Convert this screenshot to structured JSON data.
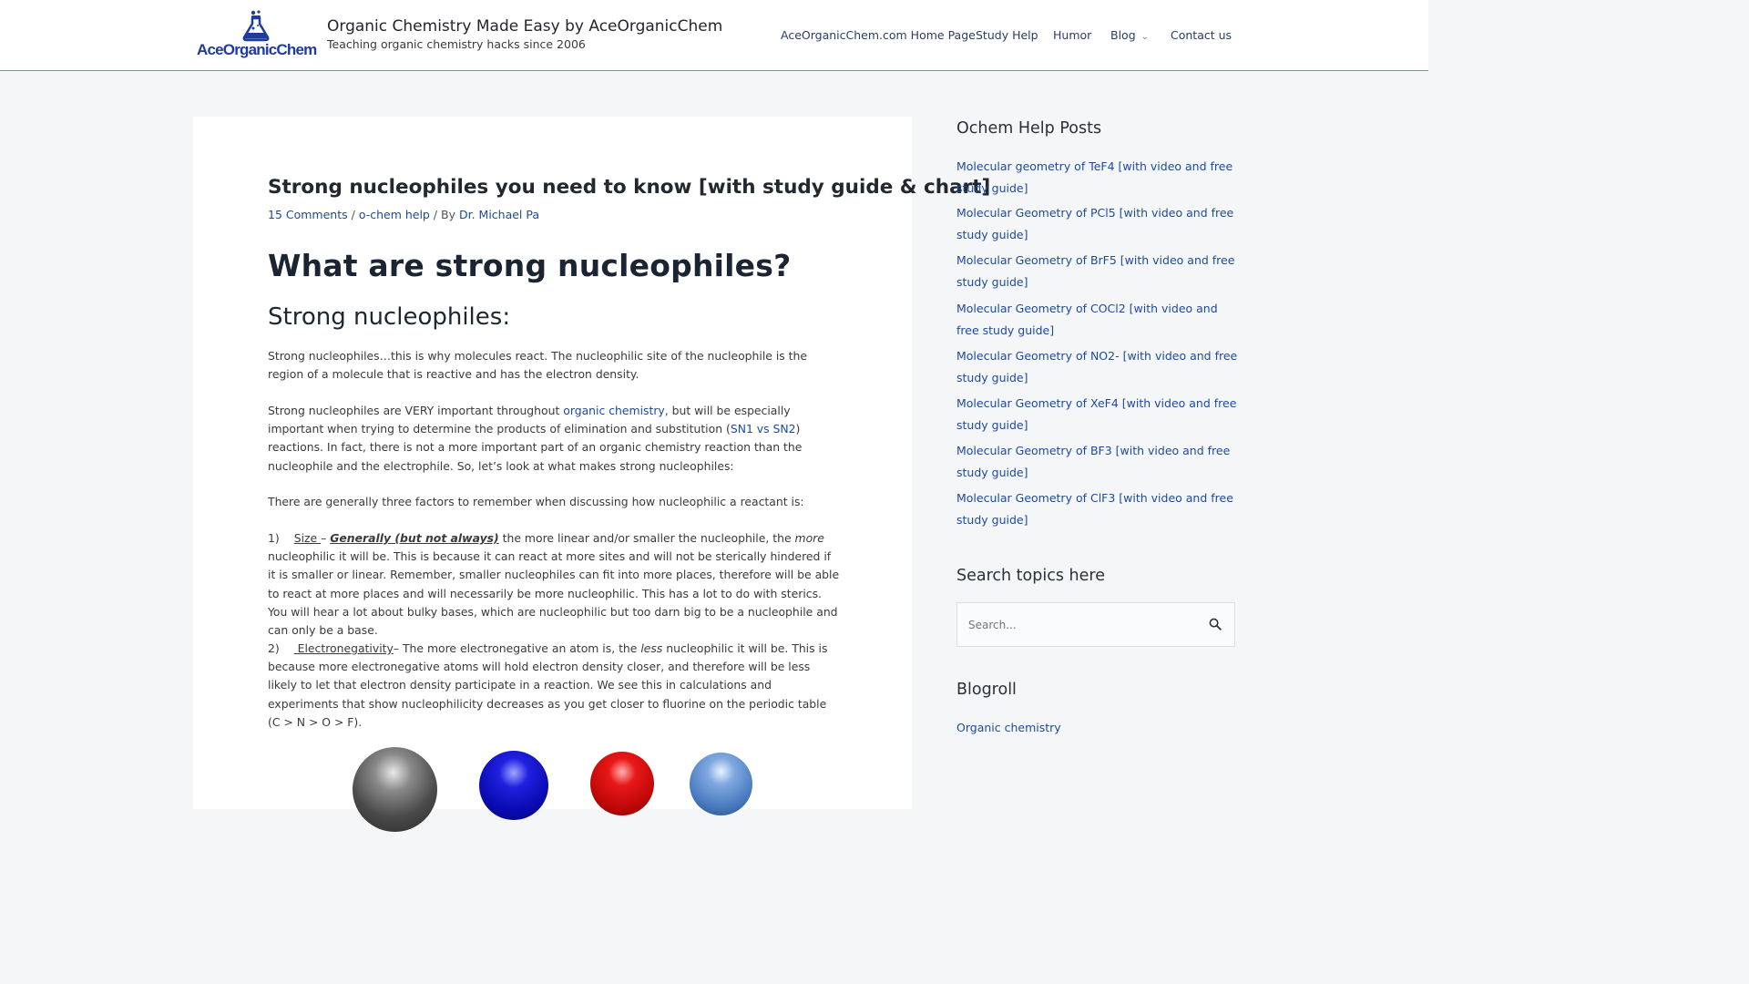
{
  "header": {
    "logo_text": "AceOrganicChem",
    "site_title": "Organic Chemistry Made Easy by AceOrganicChem",
    "tagline": "Teaching organic chemistry hacks since 2006",
    "nav": [
      {
        "label": "AceOrganicChem.com Home Page"
      },
      {
        "label": "Study Help"
      },
      {
        "label": "Humor"
      },
      {
        "label": "Blog",
        "has_dropdown": true
      },
      {
        "label": "Contact us"
      }
    ]
  },
  "article": {
    "title": "Strong nucleophiles you need to know [with study guide & chart]",
    "meta": {
      "comments": "15 Comments",
      "sep1": " / ",
      "category": "o-chem help",
      "sep2": " / By ",
      "author": "Dr. Michael Pa"
    },
    "h1": "What are strong nucleophiles?",
    "h2": "Strong nucleophiles:",
    "p1": "Strong nucleophiles…this is why molecules react. The nucleophilic site of the nucleophile is the region of a molecule that is reactive and has the electron density.",
    "p2": {
      "a": "Strong nucleophiles are VERY important throughout ",
      "link1": "organic chemistry",
      "b": ", but will be especially important when trying to determine the products of elimination and substitution (",
      "link2": "SN1 vs SN2",
      "c": ") reactions.  In fact, there is not a more important part of an organic chemistry reaction than the nucleophile and the electrophile.   So, let’s look at what makes strong nucleophiles:"
    },
    "p3": "There are generally three factors to remember when discussing how nucleophilic a reactant is:",
    "p4": {
      "num": "1)",
      "term": "Size ",
      "dash": "– ",
      "emph": "Generally (but not always)",
      "a": " the more linear and/or smaller the nucleophile, the ",
      "more": "more",
      "b": " nucleophilic it will be.  This is because it can react at more sites and will not be sterically hindered if it is smaller or linear.  Remember, smaller nucleophiles can fit into more places, therefore will be able to react at more places and will necessarily be more nucleophilic.  This has a lot to do with sterics. You will hear a lot about bulky bases, which are nucleophilic but too darn big to be a nucleophile and can only be a base."
    },
    "p5": {
      "num": "2)",
      "term": " Electronegativity",
      "a": "– The more electronegative an atom is, the ",
      "less": "less",
      "b": " nucleophilic it will be.   This is because more electronegative atoms will hold electron density closer, and therefore will be less likely to let that electron density participate in a reaction.  We see this in calculations and experiments that show nucleophilicity decreases as you get closer to fluorine on the periodic table (C > N > O > F)."
    },
    "sphere_colors": [
      "#5a5a5a",
      "#1010c8",
      "#d41010",
      "#4a7bc0"
    ]
  },
  "sidebar": {
    "posts_heading": "Ochem Help Posts",
    "posts": [
      "Molecular geometry of TeF4 [with video and free study guide]",
      "Molecular Geometry of PCl5 [with video and free study guide]",
      "Molecular Geometry of BrF5 [with video and free study guide]",
      "Molecular Geometry of COCl2 [with video and free study guide]",
      "Molecular Geometry of NO2- [with video and free study guide]",
      "Molecular Geometry of XeF4 [with video and free study guide]",
      "Molecular Geometry of BF3 [with video and free study guide]",
      "Molecular Geometry of ClF3 [with video and free study guide]"
    ],
    "search_heading": "Search topics here",
    "search_placeholder": "Search...",
    "blogroll_heading": "Blogroll",
    "blogroll_link": "Organic chemistry"
  }
}
